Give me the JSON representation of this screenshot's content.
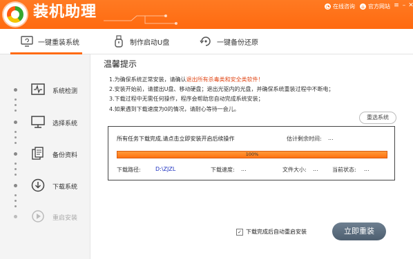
{
  "header": {
    "title": "装机助理",
    "online_consult": "在线咨询",
    "official_site": "官方网站",
    "controls": [
      "≡",
      "–",
      "✕"
    ]
  },
  "tabs": [
    {
      "label": "一键重装系统",
      "icon": "monitor-refresh-icon",
      "active": true
    },
    {
      "label": "制作启动U盘",
      "icon": "usb-drive-icon",
      "active": false
    },
    {
      "label": "一键备份还原",
      "icon": "backup-restore-icon",
      "active": false
    }
  ],
  "sidebar": {
    "items": [
      {
        "label": "系统检测",
        "icon": "pulse-monitor-icon",
        "enabled": true
      },
      {
        "label": "选择系统",
        "icon": "desktop-icon",
        "enabled": true
      },
      {
        "label": "备份资料",
        "icon": "documents-icon",
        "enabled": true
      },
      {
        "label": "下载系统",
        "icon": "download-icon",
        "enabled": true
      },
      {
        "label": "重启安装",
        "icon": "restart-play-icon",
        "enabled": false
      }
    ]
  },
  "main": {
    "title": "温馨提示",
    "tips": {
      "t1_pre": "1.为确保系统正常安装，请确认",
      "t1_warn": "退出所有杀毒类和安全类软件！",
      "t2": "2.安装开始前，请拔出U盘、移动硬盘；退出光驱内的光盘，并确保系统重装过程中不断电；",
      "t3": "3.下载过程中无需任何操作，程序会帮助您自动完成系统安装；",
      "t4": "4.如果遇到下载速度为0的情况，请耐心等待一会儿。"
    },
    "reselect_label": "重选系统",
    "panel": {
      "task_status": "所有任务下载完成,请点击立即安装开启后续操作",
      "eta_label": "估计剩余时间:",
      "eta_value": "...",
      "progress_percent": 100,
      "progress_text": "100%",
      "path_label": "下载路径:",
      "path_value": "D:\\ZJZL",
      "speed_label": "下载速度:",
      "speed_value": "...",
      "size_label": "文件大小:",
      "size_value": "...",
      "state_label": "当前状态:",
      "state_value": "..."
    },
    "auto_restart_label": "下载完成后自动重启安装",
    "auto_restart_checked": true,
    "install_button": "立即重装"
  },
  "colors": {
    "brand_orange": "#ff6a10",
    "warning_text": "#e14a1a",
    "path_blue": "#1b2fbf",
    "install_button": "#5b6b7b"
  }
}
